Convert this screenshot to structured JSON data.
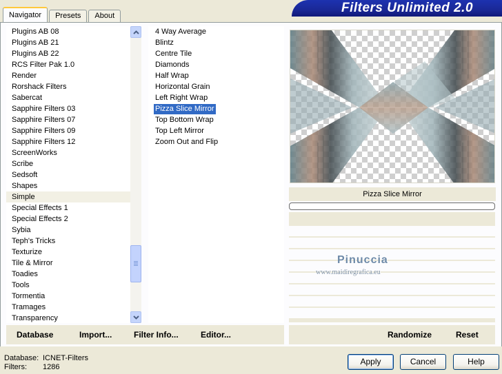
{
  "tabs": [
    {
      "label": "Navigator",
      "active": true
    },
    {
      "label": "Presets",
      "active": false
    },
    {
      "label": "About",
      "active": false
    }
  ],
  "app_title": "Filters Unlimited 2.0",
  "categories": [
    "Plugins AB 08",
    "Plugins AB 21",
    "Plugins AB 22",
    "RCS Filter Pak 1.0",
    "Render",
    "Rorshack Filters",
    "Sabercat",
    "Sapphire Filters 03",
    "Sapphire Filters 07",
    "Sapphire Filters 09",
    "Sapphire Filters 12",
    "ScreenWorks",
    "Scribe",
    "Sedsoft",
    "Shapes",
    "Simple",
    "Special Effects 1",
    "Special Effects 2",
    "Sybia",
    "Teph's Tricks",
    "Texturize",
    "Tile & Mirror",
    "Toadies",
    "Tools",
    "Tormentia",
    "Tramages",
    "Transparency"
  ],
  "highlighted_category": "Simple",
  "filters": [
    "4 Way Average",
    "Blintz",
    "Centre Tile",
    "Diamonds",
    "Half Wrap",
    "Horizontal Grain",
    "Left Right Wrap",
    "Pizza Slice Mirror",
    "Top Bottom Wrap",
    "Top Left Mirror",
    "Zoom Out and Flip"
  ],
  "selected_filter": "Pizza Slice Mirror",
  "preview": {
    "caption": "Pizza Slice Mirror",
    "progress": 0
  },
  "watermark": {
    "name": "Pinuccia",
    "site": "www.maidiregrafica.eu"
  },
  "left_buttons": {
    "database": "Database",
    "import": "Import...",
    "filter_info": "Filter Info...",
    "editor": "Editor..."
  },
  "right_buttons": {
    "randomize": "Randomize",
    "reset": "Reset"
  },
  "footer": {
    "database_label": "Database:",
    "database_value": "ICNET-Filters",
    "filters_label": "Filters:",
    "filters_value": "1286"
  },
  "dialog_buttons": {
    "apply": "Apply",
    "cancel": "Cancel",
    "help": "Help"
  },
  "colors": {
    "selection": "#316ac5",
    "title_bar": "#1a2896",
    "tab_accent": "#ffc83c"
  }
}
